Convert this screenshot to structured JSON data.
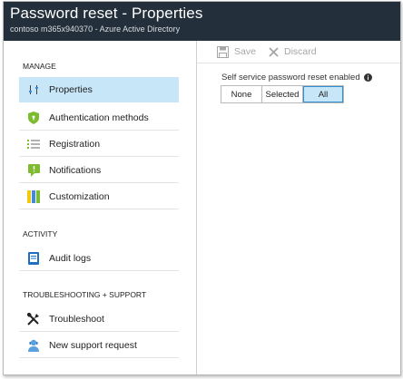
{
  "window": {
    "title": "Password reset - Properties",
    "subtitle": "contoso m365x940370 - Azure Active Directory"
  },
  "sidebar": {
    "sections": [
      {
        "label": "MANAGE",
        "items": [
          {
            "label": "Properties",
            "icon": "properties-sliders-icon",
            "selected": true
          },
          {
            "label": "Authentication methods",
            "icon": "shield-icon",
            "selected": false
          },
          {
            "label": "Registration",
            "icon": "checklist-icon",
            "selected": false
          },
          {
            "label": "Notifications",
            "icon": "notification-icon",
            "selected": false
          },
          {
            "label": "Customization",
            "icon": "customization-icon",
            "selected": false
          }
        ]
      },
      {
        "label": "ACTIVITY",
        "items": [
          {
            "label": "Audit logs",
            "icon": "audit-log-icon",
            "selected": false
          }
        ]
      },
      {
        "label": "TROUBLESHOOTING + SUPPORT",
        "items": [
          {
            "label": "Troubleshoot",
            "icon": "wrench-icon",
            "selected": false
          },
          {
            "label": "New support request",
            "icon": "support-person-icon",
            "selected": false
          }
        ]
      }
    ]
  },
  "toolbar": {
    "save_label": "Save",
    "discard_label": "Discard"
  },
  "settings": {
    "sspr_label": "Self service password reset enabled",
    "sspr_options": [
      "None",
      "Selected",
      "All"
    ],
    "sspr_selected": "All"
  },
  "colors": {
    "header_bg": "#232f3a",
    "selected_bg": "#c7e6f7",
    "accent": "#2f8fd3"
  }
}
